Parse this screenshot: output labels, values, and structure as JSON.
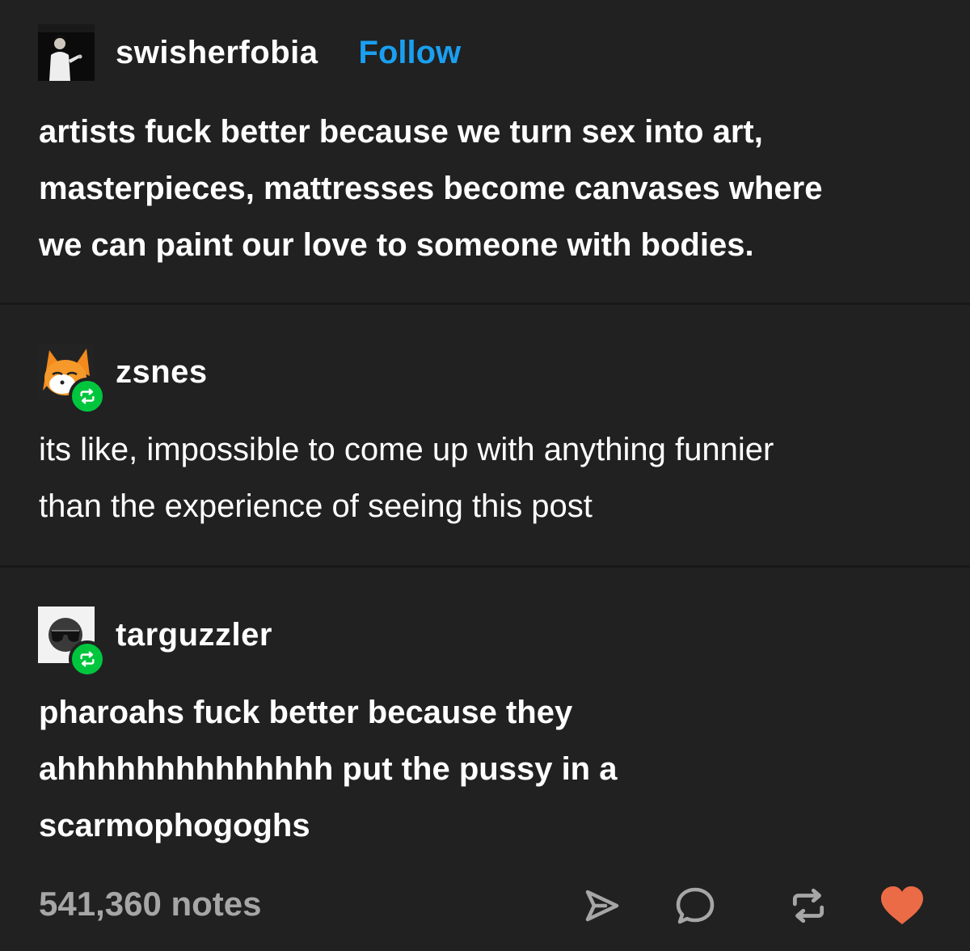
{
  "colors": {
    "background": "#212121",
    "divider": "#181818",
    "text": "#ffffff",
    "follow": "#1a9ff0",
    "reblog_badge": "#00c63e",
    "notes": "#a6a6a6",
    "heart": "#ec6b47"
  },
  "posts": [
    {
      "username": "swisherfobia",
      "follow_label": "Follow",
      "avatar_icon": "person-photo-avatar",
      "lines": [
        "artists fuck better because we turn sex into art,",
        "masterpieces, mattresses become canvases where",
        "we can paint our love to someone with bodies."
      ]
    },
    {
      "username": "zsnes",
      "avatar_icon": "fox-avatar",
      "badge_icon": "reblog-icon",
      "lines": [
        "its like, impossible to come up with anything funnier",
        "than the experience of seeing this post"
      ]
    },
    {
      "username": "targuzzler",
      "avatar_icon": "sunglasses-avatar",
      "badge_icon": "reblog-icon",
      "lines": [
        "pharoahs fuck better because they",
        "ahhhhhhhhhhhhhh put the pussy in a",
        "scarmophogoghs"
      ]
    }
  ],
  "footer": {
    "notes": "541,360 notes",
    "actions": [
      "share-icon",
      "reply-icon",
      "reblog-icon",
      "like-heart-icon"
    ]
  }
}
